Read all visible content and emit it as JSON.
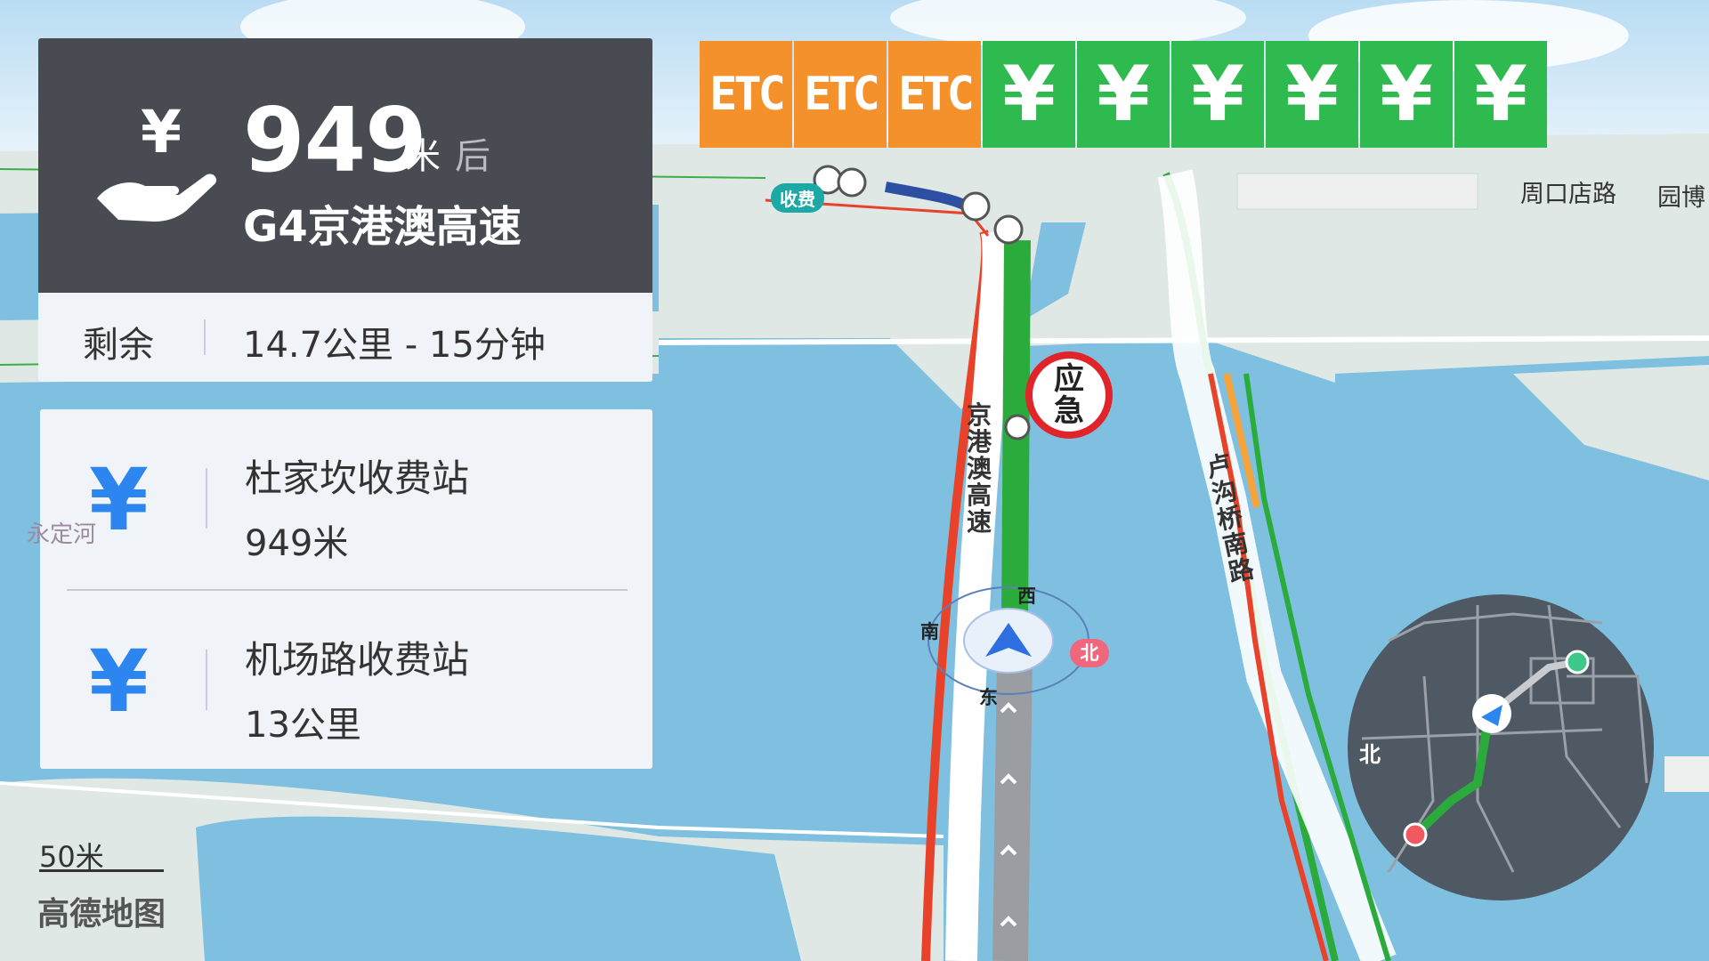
{
  "guidance": {
    "distance": "949",
    "unit": "米",
    "after": "后",
    "road": "G4京港澳高速",
    "icon": "toll-hand-yen-icon"
  },
  "remaining": {
    "label": "剩余",
    "value": "14.7公里 - 15分钟"
  },
  "toll_stations": [
    {
      "icon": "yen-icon",
      "symbol": "¥",
      "name": "杜家坎收费站",
      "distance": "949米"
    },
    {
      "icon": "yen-icon",
      "symbol": "¥",
      "name": "机场路收费站",
      "distance": "13公里"
    }
  ],
  "lanes": [
    {
      "type": "etc",
      "label": "ETC"
    },
    {
      "type": "etc",
      "label": "ETC"
    },
    {
      "type": "etc",
      "label": "ETC"
    },
    {
      "type": "cash",
      "label": "¥"
    },
    {
      "type": "cash",
      "label": "¥"
    },
    {
      "type": "cash",
      "label": "¥"
    },
    {
      "type": "cash",
      "label": "¥"
    },
    {
      "type": "cash",
      "label": "¥"
    },
    {
      "type": "cash",
      "label": "¥"
    }
  ],
  "map": {
    "road_labels": {
      "zhoukou": "周口店路",
      "yuanbo": "园博",
      "highway": "京港澳高速",
      "lugouqiao": "卢沟桥南路",
      "yongding": "永定河"
    },
    "toll_bubble": "收费",
    "emergency": "应急",
    "compass": {
      "west": "西",
      "south": "南",
      "east": "东",
      "north": "北"
    },
    "minimap_north": "北",
    "scale": "50米",
    "brand": "高德地图"
  },
  "colors": {
    "water": "#7fc0e0",
    "land": "#dfe8e4",
    "traffic_green": "#2bab3b",
    "traffic_red": "#e8432a",
    "lane_etc": "#f5912a",
    "lane_cash": "#2fba4f",
    "panel_dark": "#484c52",
    "accent_blue": "#2d86f0"
  }
}
